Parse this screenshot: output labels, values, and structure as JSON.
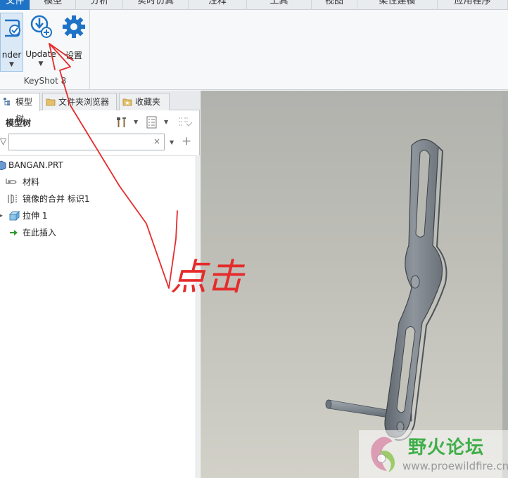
{
  "menu": {
    "items": [
      {
        "label": "文件",
        "active": true,
        "width": 47
      },
      {
        "label": "模型",
        "width": 70
      },
      {
        "label": "分析",
        "width": 73
      },
      {
        "label": "实时仿真",
        "width": 100
      },
      {
        "label": "注释",
        "width": 90
      },
      {
        "label": "工具",
        "width": 100
      },
      {
        "label": "视图",
        "width": 70
      },
      {
        "label": "柔性建模",
        "width": 124
      },
      {
        "label": "应用程序",
        "width": 108
      }
    ]
  },
  "ribbon": {
    "render_label": "nder",
    "update_label": "Update",
    "settings_label": "设置",
    "group_label": "KeyShot 8",
    "dropdown_glyph": "▼"
  },
  "tabs": {
    "model_tree": "模型树",
    "file_browser": "文件夹浏览器",
    "favorites": "收藏夹"
  },
  "tree": {
    "title": "模型树",
    "search_value": "",
    "clear_glyph": "×",
    "add_glyph": "+",
    "nodes": [
      {
        "label": "BANGAN.PRT"
      },
      {
        "label": "材料"
      },
      {
        "label": "镜像的合并 标识1"
      },
      {
        "label": "拉伸 1"
      },
      {
        "label": "在此插入"
      }
    ]
  },
  "annotation": {
    "handwritten_text": "点击"
  },
  "watermark": {
    "title": "野火论坛",
    "url": "www.proewildfire.cn"
  },
  "colors": {
    "accent": "#1f73c6",
    "annotation": "#e52b2b",
    "watermark_green": "#3fae49"
  }
}
